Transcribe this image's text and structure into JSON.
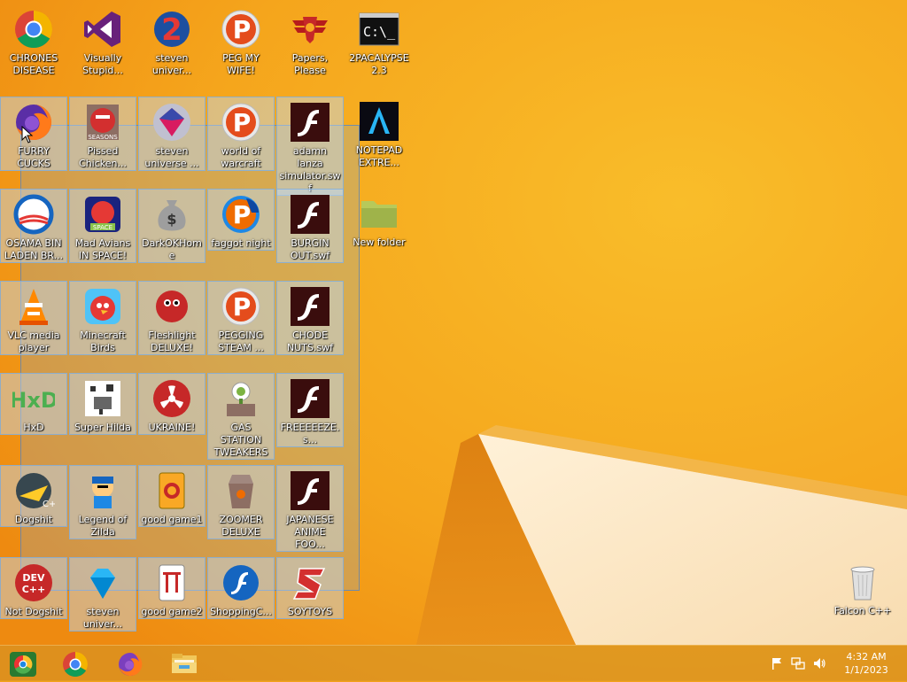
{
  "desktop": {
    "icons": [
      {
        "label": "CHRONES DISEASE",
        "icon": "chrome-icon"
      },
      {
        "label": "Visually Stupid...",
        "icon": "visual-studio-icon"
      },
      {
        "label": "steven univer...",
        "icon": "game2-icon"
      },
      {
        "label": "PEG MY WIFE!",
        "icon": "peggle-icon"
      },
      {
        "label": "Papers, Please",
        "icon": "papers-please-icon"
      },
      {
        "label": "2PACALYPSE 2.3",
        "icon": "terminal-icon"
      },
      {
        "label": "FURRY CUCKS",
        "icon": "firefox-icon"
      },
      {
        "label": "Pissed Chicken...",
        "icon": "angry-birds-seasons-icon"
      },
      {
        "label": "steven universe ...",
        "icon": "gem-icon"
      },
      {
        "label": "world of warcraft",
        "icon": "peggle-icon"
      },
      {
        "label": "adamn lanza simulator.swf",
        "icon": "flash-icon"
      },
      {
        "label": "NOTEPAD EXTRE...",
        "icon": "notepad-icon"
      },
      {
        "label": "OSAMA BIN LADEN BR...",
        "icon": "obama-logo-icon"
      },
      {
        "label": "Mad Avians IN SPACE!",
        "icon": "angry-birds-space-icon"
      },
      {
        "label": "DarkOKHome",
        "icon": "money-bag-icon"
      },
      {
        "label": "faggot night",
        "icon": "peggle-nights-icon"
      },
      {
        "label": "BURGIN OUT.swf",
        "icon": "flash-icon"
      },
      {
        "label": "New folder",
        "icon": "folder-icon"
      },
      {
        "label": "VLC media player",
        "icon": "vlc-icon"
      },
      {
        "label": "Minecraft Birds",
        "icon": "angry-birds-icon"
      },
      {
        "label": "Fleshlight DELUXE!",
        "icon": "red-fuzzy-icon"
      },
      {
        "label": "PEGGING STEAM ...",
        "icon": "peggle-icon"
      },
      {
        "label": "CHODE NUTS.swf",
        "icon": "flash-icon"
      },
      {
        "label": "HxD",
        "icon": "hxd-icon"
      },
      {
        "label": "Super Hilda",
        "icon": "pixel-icon"
      },
      {
        "label": "UKRAINE!",
        "icon": "radiation-icon"
      },
      {
        "label": "GAS STATION TWEAKERS",
        "icon": "plants-zombies-icon"
      },
      {
        "label": "FREEEEEZE.s...",
        "icon": "flash-icon"
      },
      {
        "label": "Dogshit",
        "icon": "codeblocks-icon"
      },
      {
        "label": "Legend of Zilda",
        "icon": "ninja-icon"
      },
      {
        "label": "good game1",
        "icon": "mahjong-icon"
      },
      {
        "label": "ZOOMER DELUXE",
        "icon": "zuma-icon"
      },
      {
        "label": "JAPANESE ANIME FOO...",
        "icon": "flash-icon"
      },
      {
        "label": "Not Dogshit",
        "icon": "devcpp-icon"
      },
      {
        "label": "steven univer...",
        "icon": "diamond-icon"
      },
      {
        "label": "good game2",
        "icon": "mahjong-gate-icon"
      },
      {
        "label": "ShoppingC...",
        "icon": "flash-ball-icon"
      },
      {
        "label": "SOYTOYS",
        "icon": "s-logo-icon"
      },
      {
        "label": "Falcon C++",
        "icon": "recycle-bin-icon"
      }
    ]
  },
  "taskbar": {
    "buttons": [
      {
        "name": "pinned-app-1",
        "icon": "chrome-alt-icon"
      },
      {
        "name": "chrome",
        "icon": "chrome-icon"
      },
      {
        "name": "firefox",
        "icon": "firefox-icon"
      },
      {
        "name": "file-explorer",
        "icon": "file-explorer-icon"
      }
    ],
    "tray": {
      "icons": [
        "flag-icon",
        "network-icon",
        "volume-icon"
      ],
      "time": "4:32 AM",
      "date": "1/1/2023"
    }
  },
  "colors": {
    "wallpaper": "#f4a21a",
    "selection": "#78aae6"
  }
}
